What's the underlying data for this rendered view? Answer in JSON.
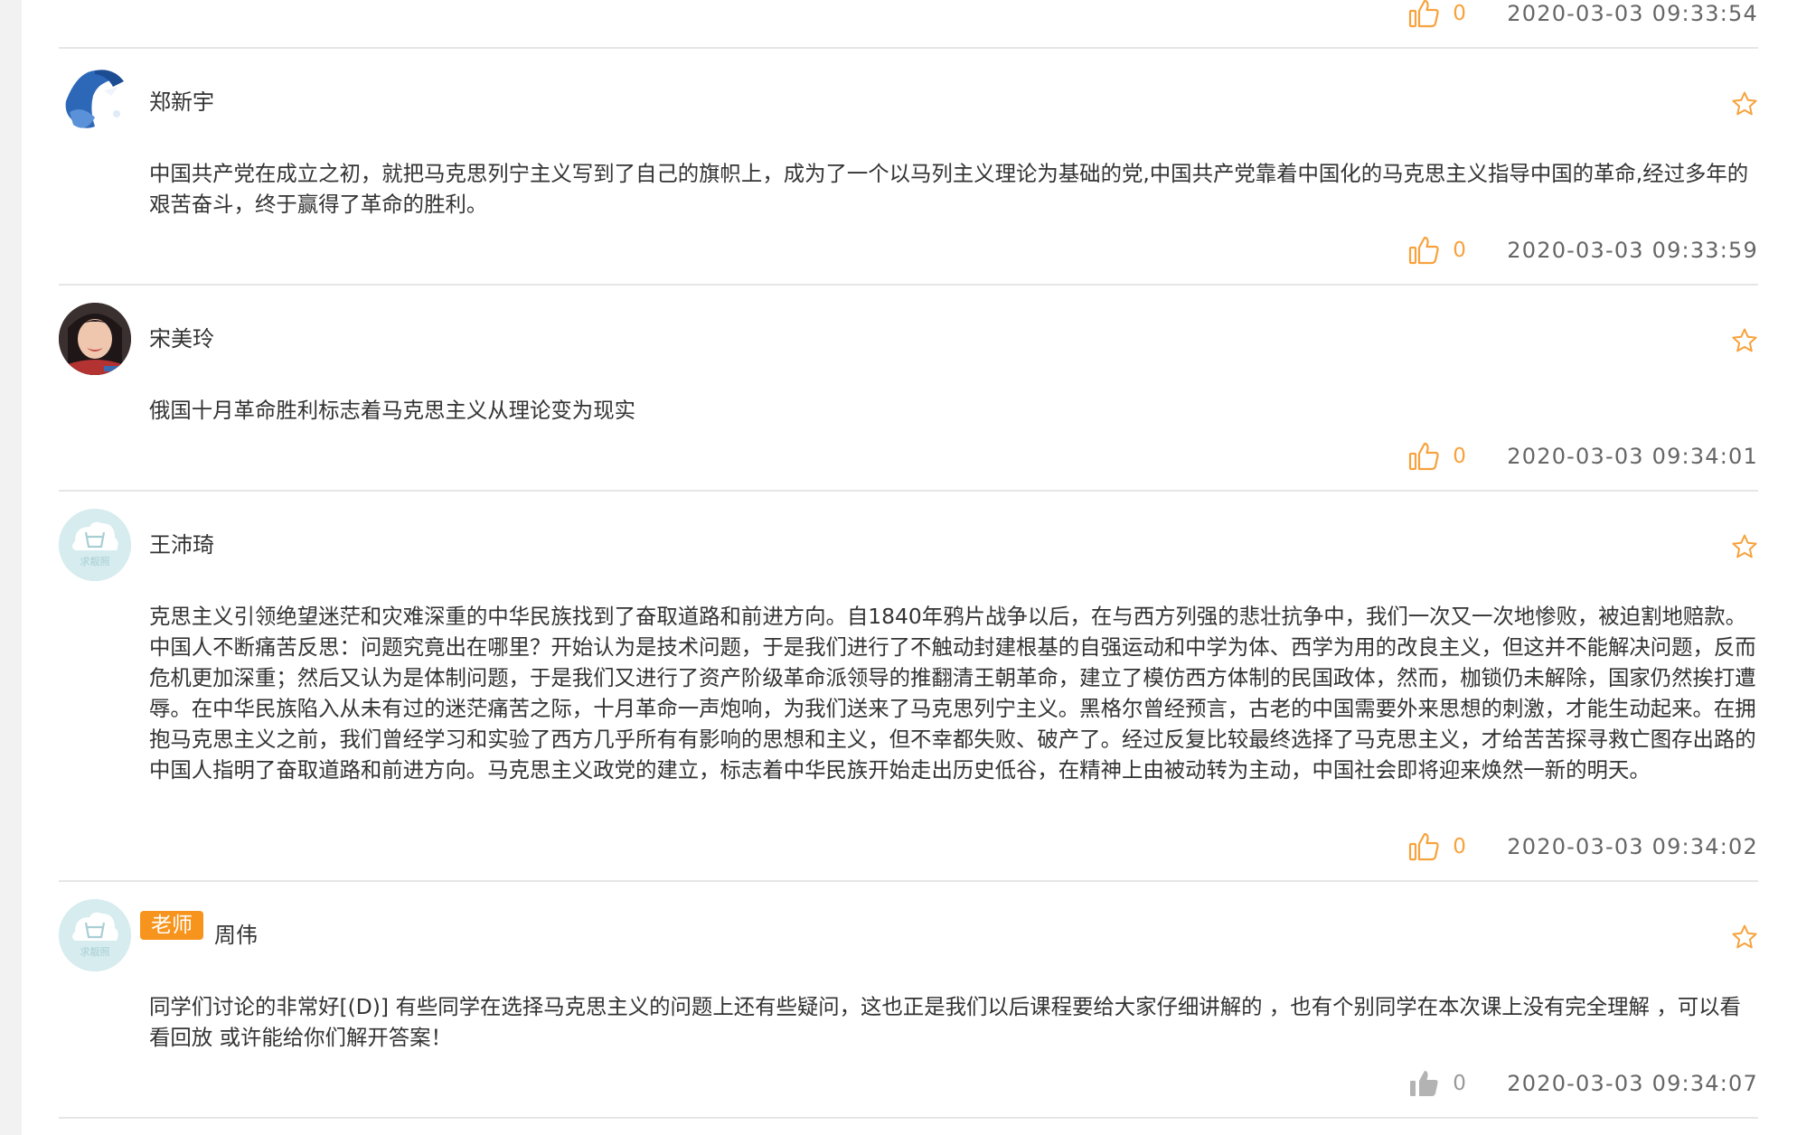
{
  "colors": {
    "accent": "#f7a23c",
    "badge": "#f7941d",
    "muted": "#b3b3b3"
  },
  "icons": {
    "like": "thumbs-up-icon",
    "favorite": "star-icon"
  },
  "top_item": {
    "likes": "0",
    "time": "2020-03-03 09:33:54"
  },
  "comments": [
    {
      "name": "郑新宇",
      "content": "中国共产党在成立之初，就把马克思列宁主义写到了自己的旗帜上，成为了一个以马列主义理论为基础的党,中国共产党靠着中国化的马克思主义指导中国的革命,经过多年的艰苦奋斗，终于赢得了革命的胜利。",
      "likes": "0",
      "time": "2020-03-03 09:33:59"
    },
    {
      "name": "宋美玲",
      "content": "俄国十月革命胜利标志着马克思主义从理论变为现实",
      "likes": "0",
      "time": "2020-03-03 09:34:01"
    },
    {
      "name": "王沛琦",
      "avatar_text": "求靓照",
      "content": "克思主义引领绝望迷茫和灾难深重的中华民族找到了奋取道路和前进方向。自1840年鸦片战争以后，在与西方列强的悲壮抗争中，我们一次又一次地惨败，被迫割地赔款。中国人不断痛苦反思：问题究竟出在哪里？开始认为是技术问题，于是我们进行了不触动封建根基的自强运动和中学为体、西学为用的改良主义，但这并不能解决问题，反而危机更加深重；然后又认为是体制问题，于是我们又进行了资产阶级革命派领导的推翻清王朝革命，建立了模仿西方体制的民国政体，然而，枷锁仍未解除，国家仍然挨打遭辱。在中华民族陷入从未有过的迷茫痛苦之际，十月革命一声炮响，为我们送来了马克思列宁主义。黑格尔曾经预言，古老的中国需要外来思想的刺激，才能生动起来。在拥抱马克思主义之前，我们曾经学习和实验了西方几乎所有有影响的思想和主义，但不幸都失败、破产了。经过反复比较最终选择了马克思主义，才给苦苦探寻救亡图存出路的中国人指明了奋取道路和前进方向。马克思主义政党的建立，标志着中华民族开始走出历史低谷，在精神上由被动转为主动，中国社会即将迎来焕然一新的明天。",
      "likes": "0",
      "time": "2020-03-03 09:34:02"
    },
    {
      "name": "周伟",
      "badge": "老师",
      "avatar_text": "求靓照",
      "content": "同学们讨论的非常好[(D)] 有些同学在选择马克思主义的问题上还有些疑问，这也正是我们以后课程要给大家仔细讲解的 ，也有个别同学在本次课上没有完全理解 ，可以看看回放 或许能给你们解开答案！",
      "likes": "0",
      "time": "2020-03-03 09:34:07"
    }
  ]
}
